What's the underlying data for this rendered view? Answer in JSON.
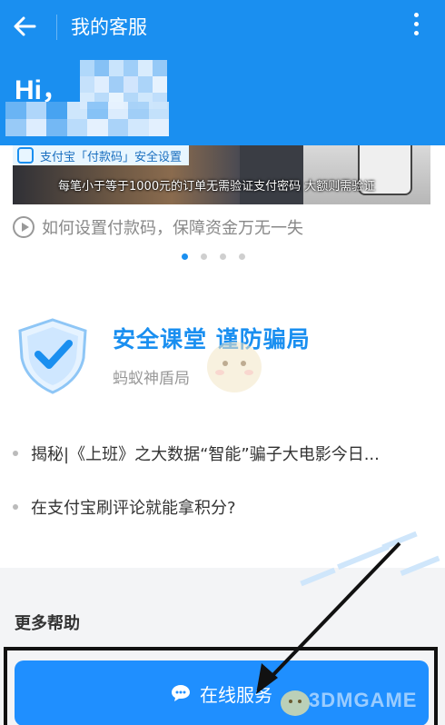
{
  "header": {
    "title": "我的客服",
    "greeting": "Hi，",
    "accent": "#1a8ff0"
  },
  "banner": {
    "tagline": "支付宝「付款码」安全设置",
    "caption": "每笔小于等于1000元的订单无需验证支付密码 大额则需验证"
  },
  "video": {
    "text": "如何设置付款码，保障资金万无一失"
  },
  "carousel": {
    "dots": 4,
    "active": 0
  },
  "security": {
    "title": "安全课堂 谨防骗局",
    "subtitle": "蚂蚁神盾局"
  },
  "news": [
    "揭秘|《上班》之大数据“智能”骗子大电影今日...",
    "在支付宝刷评论就能拿积分?"
  ],
  "more_help": "更多帮助",
  "online_button": "在线服务",
  "watermark": "3DMGAME",
  "icons": [
    "back-arrow-icon",
    "more-vertical-icon",
    "play-circle-icon",
    "shield-check-icon",
    "chat-bubble-icon"
  ]
}
